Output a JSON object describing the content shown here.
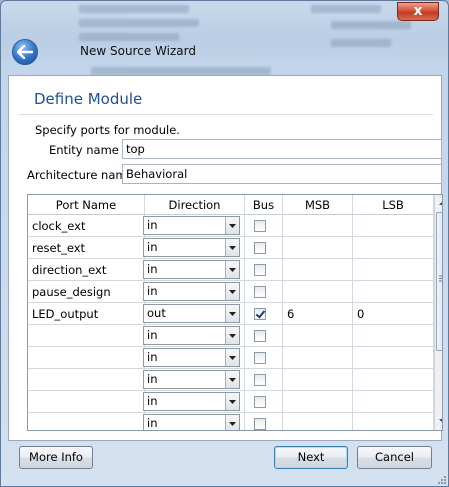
{
  "window": {
    "title": "New Source Wizard",
    "close_label": "x"
  },
  "page": {
    "heading": "Define Module",
    "instruction": "Specify ports for module."
  },
  "form": {
    "entity_label": "Entity name",
    "entity_value": "top",
    "arch_label": "Architecture name",
    "arch_value": "Behavioral"
  },
  "table": {
    "headers": [
      "Port Name",
      "Direction",
      "Bus",
      "MSB",
      "LSB"
    ],
    "rows": [
      {
        "name": "clock_ext",
        "direction": "in",
        "bus": false,
        "msb": "",
        "lsb": ""
      },
      {
        "name": "reset_ext",
        "direction": "in",
        "bus": false,
        "msb": "",
        "lsb": ""
      },
      {
        "name": "direction_ext",
        "direction": "in",
        "bus": false,
        "msb": "",
        "lsb": ""
      },
      {
        "name": "pause_design",
        "direction": "in",
        "bus": false,
        "msb": "",
        "lsb": ""
      },
      {
        "name": "LED_output",
        "direction": "out",
        "bus": true,
        "msb": "6",
        "lsb": "0"
      },
      {
        "name": "",
        "direction": "in",
        "bus": false,
        "msb": "",
        "lsb": ""
      },
      {
        "name": "",
        "direction": "in",
        "bus": false,
        "msb": "",
        "lsb": ""
      },
      {
        "name": "",
        "direction": "in",
        "bus": false,
        "msb": "",
        "lsb": ""
      },
      {
        "name": "",
        "direction": "in",
        "bus": false,
        "msb": "",
        "lsb": ""
      },
      {
        "name": "",
        "direction": "in",
        "bus": false,
        "msb": "",
        "lsb": ""
      }
    ]
  },
  "buttons": {
    "more_info": "More Info",
    "next": "Next",
    "cancel": "Cancel"
  },
  "icons": {
    "back": "back-arrow-icon",
    "close": "close-icon",
    "dropdown": "chevron-down-icon",
    "scroll_up": "scroll-up-arrow-icon",
    "scroll_down": "scroll-down-arrow-icon"
  }
}
